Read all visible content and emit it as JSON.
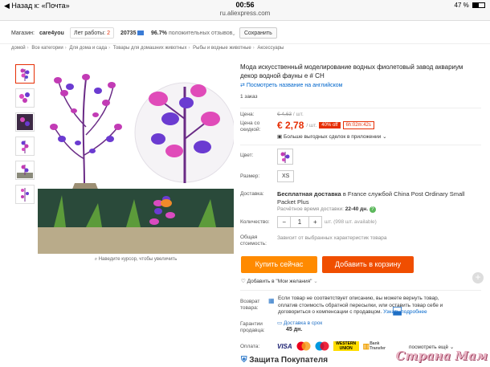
{
  "status_bar": {
    "back": "◀ Назад к: «Почта»",
    "time": "00:56",
    "url": "ru.aliexpress.com",
    "battery": "47 %"
  },
  "store": {
    "label": "Магазин:",
    "name": "care4you",
    "years_label": "Лет работы:",
    "years": "2",
    "rating_count": "20735",
    "positive": "96.7%",
    "positive_label": "положительных отзывов",
    "save_label": "Сохранить"
  },
  "breadcrumbs": [
    "домой",
    "Все категории",
    "Для дома и сада",
    "Товары для домашних животных",
    "Рыбы и водные животные",
    "Аксессуары"
  ],
  "product": {
    "title": "Мода искусственный моделирование водных фиолетовый завод аквариум декор водной фауны e # CH",
    "english_link": "Посмотреть название на английском",
    "orders": "1 заказ",
    "price_label": "Цена:",
    "old_price": "€ 4,63",
    "old_unit": "/ шт.",
    "discount_label": "Цена со скидкой:",
    "new_price": "€ 2,78",
    "new_unit": "/ шт.",
    "off": "40% off",
    "timer": "6h:02m:42s",
    "app_deals": "Больше выгодных сделок в приложении",
    "color_label": "Цвет:",
    "size_label": "Размер:",
    "size_value": "XS",
    "shipping_label": "Доставка:",
    "shipping_bold": "Бесплатная доставка",
    "shipping_rest": " в France службой China Post Ordinary Small Packet Plus",
    "shipping_time_label": "Расчётное время доставки:",
    "shipping_time": "22-40 дн.",
    "qty_label": "Количество:",
    "qty_value": "1",
    "qty_available": "шт. (998 шт. available)",
    "total_label": "Общая стоимость:",
    "total_note": "Зависит от выбранных характеристик товара",
    "buy_label": "Купить сейчас",
    "cart_label": "Добавить в корзину",
    "wish_label": "Добавить в \"Мои желания\"",
    "return_label": "Возврат товара:",
    "return_text": "Если товар не соответствует описанию, вы можете вернуть товар, оплатив стоимость обратной пересылки, или оставить товар себе и договориться о компенсации с продавцом.",
    "return_link": "Узнать подробнее",
    "guarantee_label": "Гарантии продавца:",
    "guarantee_line": "Доставка в срок",
    "guarantee_days": "45 дн.",
    "payment_label": "Оплата:",
    "payment_more": "посмотреть ещё",
    "protection": "Защита Покупателя",
    "zoom_hint": "Наведите курсор, чтобы увеличить"
  },
  "payment_logos": [
    "VISA",
    "MasterCard",
    "Maestro",
    "WESTERN UNION",
    "Bank Transfer"
  ],
  "watermark": "Страна Мам",
  "colors": {
    "accent": "#e62e04",
    "buy": "#ff8a00",
    "cart": "#f04e00",
    "link": "#0066cc"
  }
}
